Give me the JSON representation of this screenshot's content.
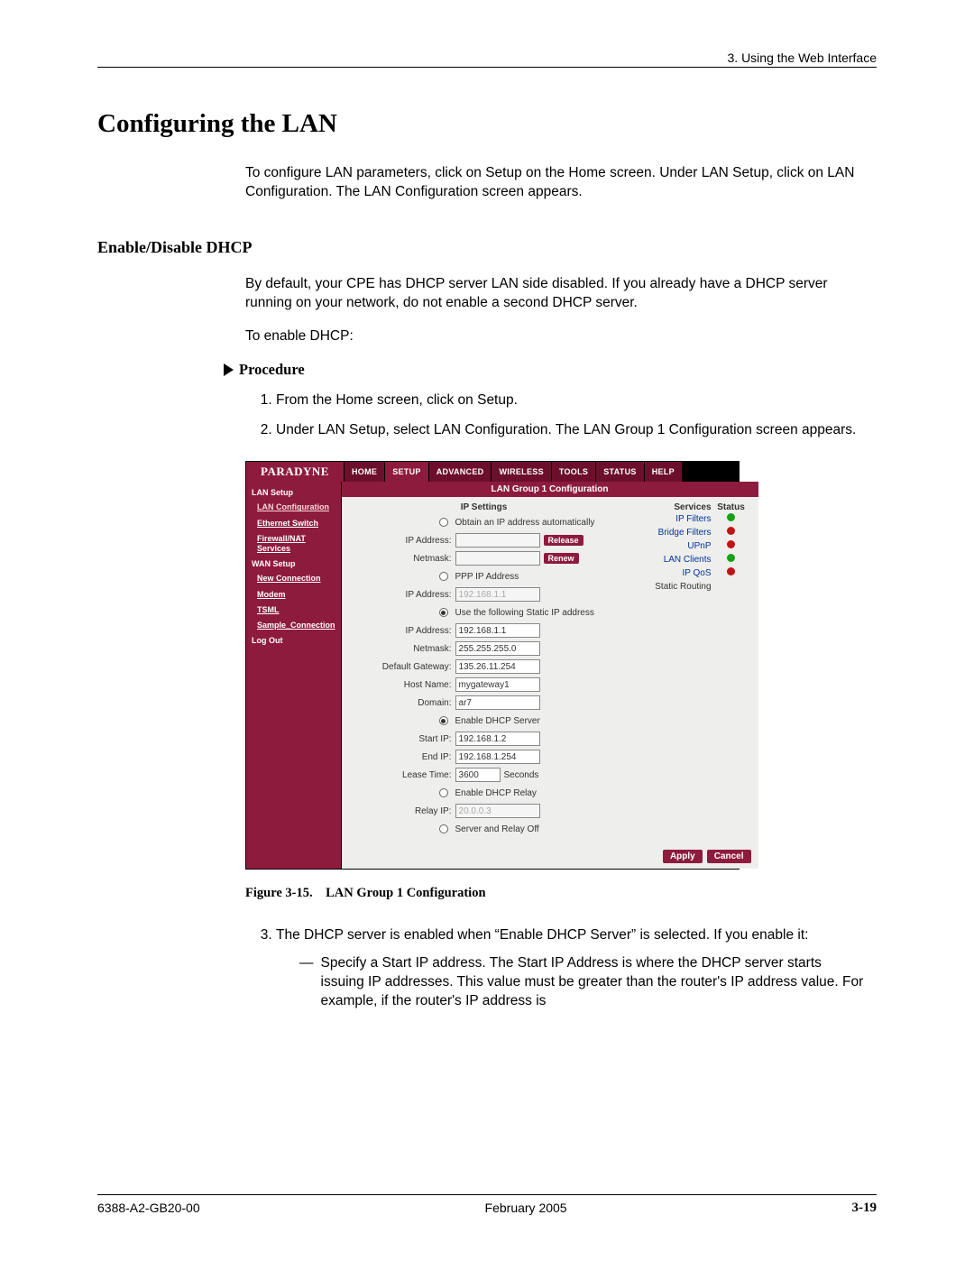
{
  "header": {
    "chapter": "3. Using the Web Interface"
  },
  "headings": {
    "h1": "Configuring the LAN",
    "h2": "Enable/Disable DHCP",
    "procedure": "Procedure"
  },
  "text": {
    "intro": "To configure LAN parameters, click on Setup on the Home screen. Under LAN Setup, click on LAN Configuration. The LAN Configuration screen appears.",
    "dhcp1": "By default, your CPE has DHCP server LAN side disabled. If you already have a DHCP server running on your network, do not enable a second DHCP server.",
    "dhcp2": "To enable DHCP:"
  },
  "procedure_steps": {
    "s1": "From the Home screen, click on Setup.",
    "s2": "Under LAN Setup, select LAN Configuration. The LAN Group 1 Configuration screen appears."
  },
  "figure": {
    "brand": "PARADYNE",
    "tabs": [
      "HOME",
      "SETUP",
      "ADVANCED",
      "WIRELESS",
      "TOOLS",
      "STATUS",
      "HELP"
    ],
    "sidebar": {
      "lan_setup": "LAN Setup",
      "lan_items": [
        "LAN Configuration",
        "Ethernet Switch",
        "Firewall/NAT Services"
      ],
      "wan_setup": "WAN Setup",
      "wan_items": [
        "New Connection",
        "Modem",
        "TSML",
        "Sample_Connection"
      ],
      "logout": "Log Out"
    },
    "main_title": "LAN Group 1 Configuration",
    "ip_settings_heading": "IP Settings",
    "radios": {
      "auto": "Obtain an IP address automatically",
      "ppp": "PPP IP Address",
      "static": "Use the following Static IP address",
      "dhcp_server": "Enable DHCP Server",
      "dhcp_relay": "Enable DHCP Relay",
      "off": "Server and Relay Off"
    },
    "labels": {
      "ip_address": "IP Address:",
      "netmask": "Netmask:",
      "default_gw": "Default Gateway:",
      "host_name": "Host Name:",
      "domain": "Domain:",
      "start_ip": "Start IP:",
      "end_ip": "End IP:",
      "lease_time": "Lease Time:",
      "relay_ip": "Relay IP:",
      "seconds": "Seconds"
    },
    "values": {
      "ip_disabled": "192.168.1.1",
      "static_ip": "192.168.1.1",
      "static_netmask": "255.255.255.0",
      "default_gw": "135.26.11.254",
      "host_name": "mygateway1",
      "domain": "ar7",
      "start_ip": "192.168.1.2",
      "end_ip": "192.168.1.254",
      "lease_time": "3600",
      "relay_ip": "20.0.0.3"
    },
    "buttons": {
      "release": "Release",
      "renew": "Renew",
      "apply": "Apply",
      "cancel": "Cancel"
    },
    "services_heading": {
      "col1": "Services",
      "col2": "Status"
    },
    "services": [
      {
        "name": "IP Filters",
        "status": "green"
      },
      {
        "name": "Bridge Filters",
        "status": "red"
      },
      {
        "name": "UPnP",
        "status": "red"
      },
      {
        "name": "LAN Clients",
        "status": "green"
      },
      {
        "name": "IP QoS",
        "status": "red"
      }
    ],
    "static_routing": "Static Routing"
  },
  "figure_caption": "Figure 3-15. LAN Group 1 Configuration",
  "continued": {
    "s3": "The DHCP server is enabled when “Enable DHCP Server” is selected. If you enable it:",
    "sub1": "Specify a Start IP address. The Start IP Address is where the DHCP server starts issuing IP addresses. This value must be greater than the router's IP address value. For example, if the router's IP address is"
  },
  "footer": {
    "doc": "6388-A2-GB20-00",
    "date": "February 2005",
    "page": "3-19"
  }
}
